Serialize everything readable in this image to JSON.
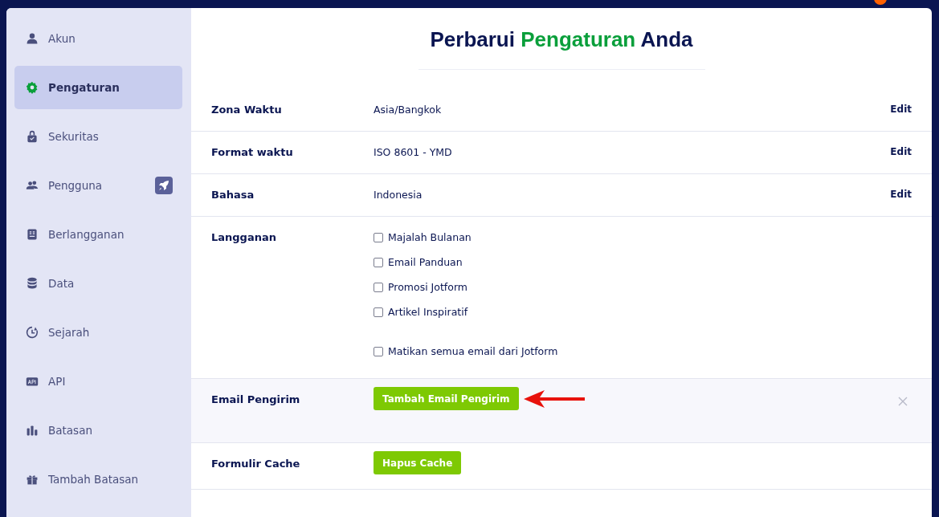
{
  "sidebar": {
    "items": [
      {
        "label": "Akun",
        "selected": false,
        "upgrade_badge": false
      },
      {
        "label": "Pengaturan",
        "selected": true,
        "upgrade_badge": false
      },
      {
        "label": "Sekuritas",
        "selected": false,
        "upgrade_badge": false
      },
      {
        "label": "Pengguna",
        "selected": false,
        "upgrade_badge": true
      },
      {
        "label": "Berlangganan",
        "selected": false,
        "upgrade_badge": false
      },
      {
        "label": "Data",
        "selected": false,
        "upgrade_badge": false
      },
      {
        "label": "Sejarah",
        "selected": false,
        "upgrade_badge": false
      },
      {
        "label": "API",
        "selected": false,
        "upgrade_badge": false
      },
      {
        "label": "Batasan",
        "selected": false,
        "upgrade_badge": false
      },
      {
        "label": "Tambah Batasan",
        "selected": false,
        "upgrade_badge": false
      }
    ]
  },
  "title": {
    "before": "Perbarui",
    "highlight": "Pengaturan",
    "after": "Anda"
  },
  "settings": [
    {
      "kind": "text",
      "label": "Zona Waktu",
      "value": "Asia/Bangkok",
      "action": "Edit",
      "highlighted": false
    },
    {
      "kind": "text",
      "label": "Format waktu",
      "value": "ISO 8601 - YMD",
      "action": "Edit",
      "highlighted": false
    },
    {
      "kind": "text",
      "label": "Bahasa",
      "value": "Indonesia",
      "action": "Edit",
      "highlighted": false
    },
    {
      "kind": "checkboxes",
      "label": "Langganan",
      "highlighted": false,
      "options": [
        {
          "label": "Majalah Bulanan",
          "checked": false
        },
        {
          "label": "Email Panduan",
          "checked": false
        },
        {
          "label": "Promosi Jotform",
          "checked": false
        },
        {
          "label": "Artikel Inspiratif",
          "checked": false
        }
      ],
      "extra_option": {
        "label": "Matikan semua email dari Jotform",
        "checked": false
      }
    },
    {
      "kind": "button",
      "label": "Email Pengirim",
      "button": "Tambah Email Pengirim",
      "highlighted": true,
      "closable": true
    },
    {
      "kind": "button",
      "label": "Formulir Cache",
      "button": "Hapus Cache",
      "highlighted": false,
      "closable": false
    }
  ]
}
